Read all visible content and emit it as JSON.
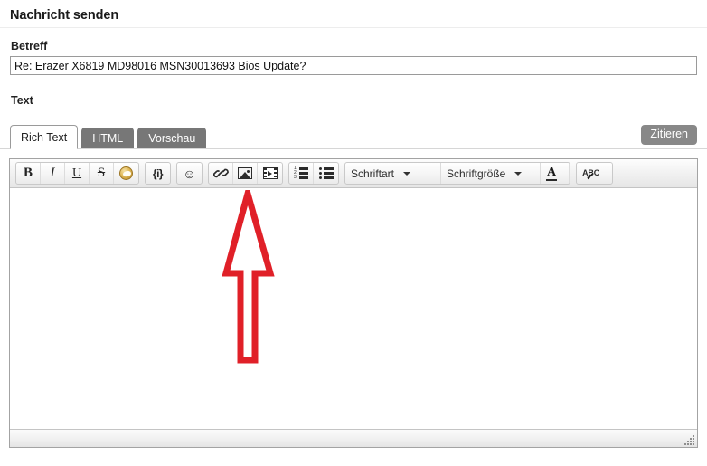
{
  "page": {
    "title": "Nachricht senden"
  },
  "form": {
    "subject": {
      "label": "Betreff",
      "value": "Re: Erazer X6819 MD98016 MSN30013693 Bios Update?",
      "placeholder": ""
    },
    "text": {
      "label": "Text",
      "value": ""
    }
  },
  "tabs": [
    {
      "label": "Rich Text",
      "active": true
    },
    {
      "label": "HTML",
      "active": false
    },
    {
      "label": "Vorschau",
      "active": false
    }
  ],
  "actions": {
    "quote_label": "Zitieren"
  },
  "toolbar": {
    "groups": [
      {
        "name": "formatting",
        "buttons": [
          {
            "icon": "bold-icon",
            "label": "B"
          },
          {
            "icon": "italic-icon",
            "label": "I"
          },
          {
            "icon": "underline-icon",
            "label": "U"
          },
          {
            "icon": "strikethrough-icon",
            "label": "S"
          },
          {
            "icon": "highlight-bucket-icon",
            "label": ""
          }
        ]
      },
      {
        "name": "code",
        "buttons": [
          {
            "icon": "bbcode-icon",
            "label": "{i}"
          }
        ]
      },
      {
        "name": "smiley",
        "buttons": [
          {
            "icon": "smiley-icon",
            "label": "☺"
          }
        ]
      },
      {
        "name": "insert",
        "buttons": [
          {
            "icon": "link-icon",
            "label": ""
          },
          {
            "icon": "image-icon",
            "label": ""
          },
          {
            "icon": "video-icon",
            "label": ""
          }
        ]
      },
      {
        "name": "lists",
        "buttons": [
          {
            "icon": "numbered-list-icon",
            "label": ""
          },
          {
            "icon": "bulleted-list-icon",
            "label": ""
          }
        ]
      }
    ],
    "font_name": "Schriftart",
    "font_size": "Schriftgröße",
    "font_color": "A",
    "spellcheck": "ABC"
  },
  "annotation": {
    "type": "arrow-up",
    "color": "#E02028",
    "points_to": "image-icon"
  },
  "colors": {
    "tab_inactive_bg": "#777777",
    "quote_button_bg": "#888888",
    "border": "#a3a3a3",
    "annotation_red": "#E02028"
  }
}
